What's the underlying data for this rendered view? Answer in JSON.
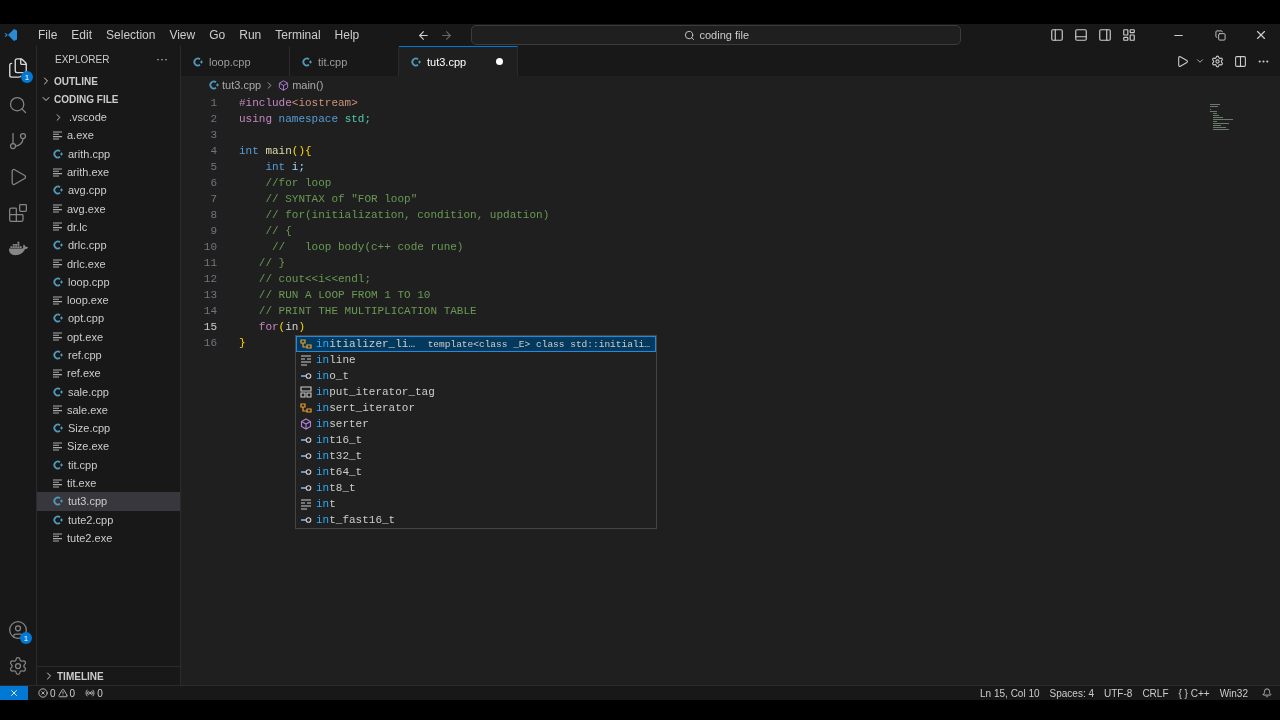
{
  "menu": [
    "File",
    "Edit",
    "Selection",
    "View",
    "Go",
    "Run",
    "Terminal",
    "Help"
  ],
  "search": {
    "value": "coding file"
  },
  "activity_badges": {
    "explorer": "1",
    "accounts": "1"
  },
  "sidebar": {
    "title": "EXPLORER",
    "more": "···",
    "sections": [
      {
        "label": "OUTLINE",
        "expanded": false
      },
      {
        "label": "CODING FILE",
        "expanded": true
      }
    ],
    "files": [
      {
        "name": ".vscode",
        "kind": "folder",
        "selected": false
      },
      {
        "name": "a.exe",
        "kind": "exe",
        "selected": false
      },
      {
        "name": "arith.cpp",
        "kind": "cpp",
        "selected": false
      },
      {
        "name": "arith.exe",
        "kind": "exe",
        "selected": false
      },
      {
        "name": "avg.cpp",
        "kind": "cpp",
        "selected": false
      },
      {
        "name": "avg.exe",
        "kind": "exe",
        "selected": false
      },
      {
        "name": "dr.lc",
        "kind": "exe",
        "selected": false
      },
      {
        "name": "drlc.cpp",
        "kind": "cpp",
        "selected": false
      },
      {
        "name": "drlc.exe",
        "kind": "exe",
        "selected": false
      },
      {
        "name": "loop.cpp",
        "kind": "cpp",
        "selected": false
      },
      {
        "name": "loop.exe",
        "kind": "exe",
        "selected": false
      },
      {
        "name": "opt.cpp",
        "kind": "cpp",
        "selected": false
      },
      {
        "name": "opt.exe",
        "kind": "exe",
        "selected": false
      },
      {
        "name": "ref.cpp",
        "kind": "cpp",
        "selected": false
      },
      {
        "name": "ref.exe",
        "kind": "exe",
        "selected": false
      },
      {
        "name": "sale.cpp",
        "kind": "cpp",
        "selected": false
      },
      {
        "name": "sale.exe",
        "kind": "exe",
        "selected": false
      },
      {
        "name": "Size.cpp",
        "kind": "cpp",
        "selected": false
      },
      {
        "name": "Size.exe",
        "kind": "exe",
        "selected": false
      },
      {
        "name": "tit.cpp",
        "kind": "cpp",
        "selected": false
      },
      {
        "name": "tit.exe",
        "kind": "exe",
        "selected": false
      },
      {
        "name": "tut3.cpp",
        "kind": "cpp",
        "selected": true
      },
      {
        "name": "tute2.cpp",
        "kind": "cpp",
        "selected": false
      },
      {
        "name": "tute2.exe",
        "kind": "exe",
        "selected": false
      }
    ],
    "timeline": {
      "label": "TIMELINE",
      "expanded": false
    }
  },
  "tabs": [
    {
      "label": "loop.cpp",
      "selected": false,
      "modified": false
    },
    {
      "label": "tit.cpp",
      "selected": false,
      "modified": false
    },
    {
      "label": "tut3.cpp",
      "selected": true,
      "modified": true
    }
  ],
  "breadcrumb": [
    "tut3.cpp",
    "main()"
  ],
  "code": [
    {
      "number": "1",
      "current": false,
      "tokens": [
        {
          "text": "#include",
          "kind": "preprocessor"
        },
        {
          "text": "<iostream>",
          "kind": "string"
        }
      ]
    },
    {
      "number": "2",
      "current": false,
      "tokens": [
        {
          "text": "using",
          "kind": "control"
        },
        {
          "text": " namespace",
          "kind": "keyword"
        },
        {
          "text": " std;",
          "kind": "type"
        }
      ]
    },
    {
      "number": "3",
      "current": false
    },
    {
      "number": "4",
      "current": false,
      "tokens": [
        {
          "text": "int",
          "kind": "keyword"
        },
        {
          "text": " main",
          "kind": "function"
        },
        {
          "text": "(){",
          "kind": "brace"
        }
      ]
    },
    {
      "number": "5",
      "current": false,
      "tokens": [
        {
          "text": "    int",
          "kind": "keyword"
        },
        {
          "text": " i;",
          "kind": "variable"
        }
      ]
    },
    {
      "number": "6",
      "current": false,
      "tokens": [
        {
          "text": "    //for loop",
          "kind": "comment"
        }
      ]
    },
    {
      "number": "7",
      "current": false,
      "tokens": [
        {
          "text": "    // SYNTAX of \"FOR loop\"",
          "kind": "comment"
        }
      ]
    },
    {
      "number": "8",
      "current": false,
      "tokens": [
        {
          "text": "    // for(initialization, condition, updation)",
          "kind": "comment"
        }
      ]
    },
    {
      "number": "9",
      "current": false,
      "tokens": [
        {
          "text": "    // {",
          "kind": "comment"
        }
      ]
    },
    {
      "number": "10",
      "current": false,
      "tokens": [
        {
          "text": "     //   loop body(c++ code rune)",
          "kind": "comment"
        }
      ]
    },
    {
      "number": "11",
      "current": false,
      "tokens": [
        {
          "text": "   // }",
          "kind": "comment"
        }
      ]
    },
    {
      "number": "12",
      "current": false,
      "tokens": [
        {
          "text": "   // cout<<i<<endl;",
          "kind": "comment"
        }
      ]
    },
    {
      "number": "13",
      "current": false,
      "tokens": [
        {
          "text": "   // RUN A LOOP FROM 1 TO 10",
          "kind": "comment"
        }
      ]
    },
    {
      "number": "14",
      "current": false,
      "tokens": [
        {
          "text": "   // PRINT THE MULTIPLICATION TABLE",
          "kind": "comment"
        }
      ]
    },
    {
      "number": "15",
      "current": true,
      "tokens": [
        {
          "text": "   for",
          "kind": "control"
        },
        {
          "text": "(",
          "kind": "brace"
        },
        {
          "text": "in",
          "kind": "plain"
        },
        {
          "text": ")",
          "kind": "brace"
        }
      ]
    },
    {
      "number": "16",
      "current": false,
      "tokens": [
        {
          "text": "}",
          "kind": "brace"
        }
      ]
    }
  ],
  "suggestions": [
    {
      "label": "**in**itializer_li…",
      "kind": "class",
      "selected": true,
      "detail": "template<class _E> class std::initiali…"
    },
    {
      "label": "**in**line",
      "kind": "keyword",
      "selected": false
    },
    {
      "label": "**in**o_t",
      "kind": "typedef",
      "selected": false
    },
    {
      "label": "**in**put_iterator_tag",
      "kind": "struct",
      "selected": false
    },
    {
      "label": "**in**sert_iterator",
      "kind": "class",
      "selected": false
    },
    {
      "label": "**in**serter",
      "kind": "function",
      "selected": false
    },
    {
      "label": "**in**t16_t",
      "kind": "typedef",
      "selected": false
    },
    {
      "label": "**in**t32_t",
      "kind": "typedef",
      "selected": false
    },
    {
      "label": "**in**t64_t",
      "kind": "typedef",
      "selected": false
    },
    {
      "label": "**in**t8_t",
      "kind": "typedef",
      "selected": false
    },
    {
      "label": "**in**t",
      "kind": "keyword",
      "selected": false
    },
    {
      "label": "**in**t_fast16_t",
      "kind": "typedef",
      "selected": false
    }
  ],
  "status_bar": {
    "errors": "0",
    "warnings": "0",
    "ports": "0",
    "right": [
      "Ln 15, Col 10",
      "Spaces: 4",
      "UTF-8",
      "CRLF",
      "{ } C++",
      "Win32"
    ]
  }
}
